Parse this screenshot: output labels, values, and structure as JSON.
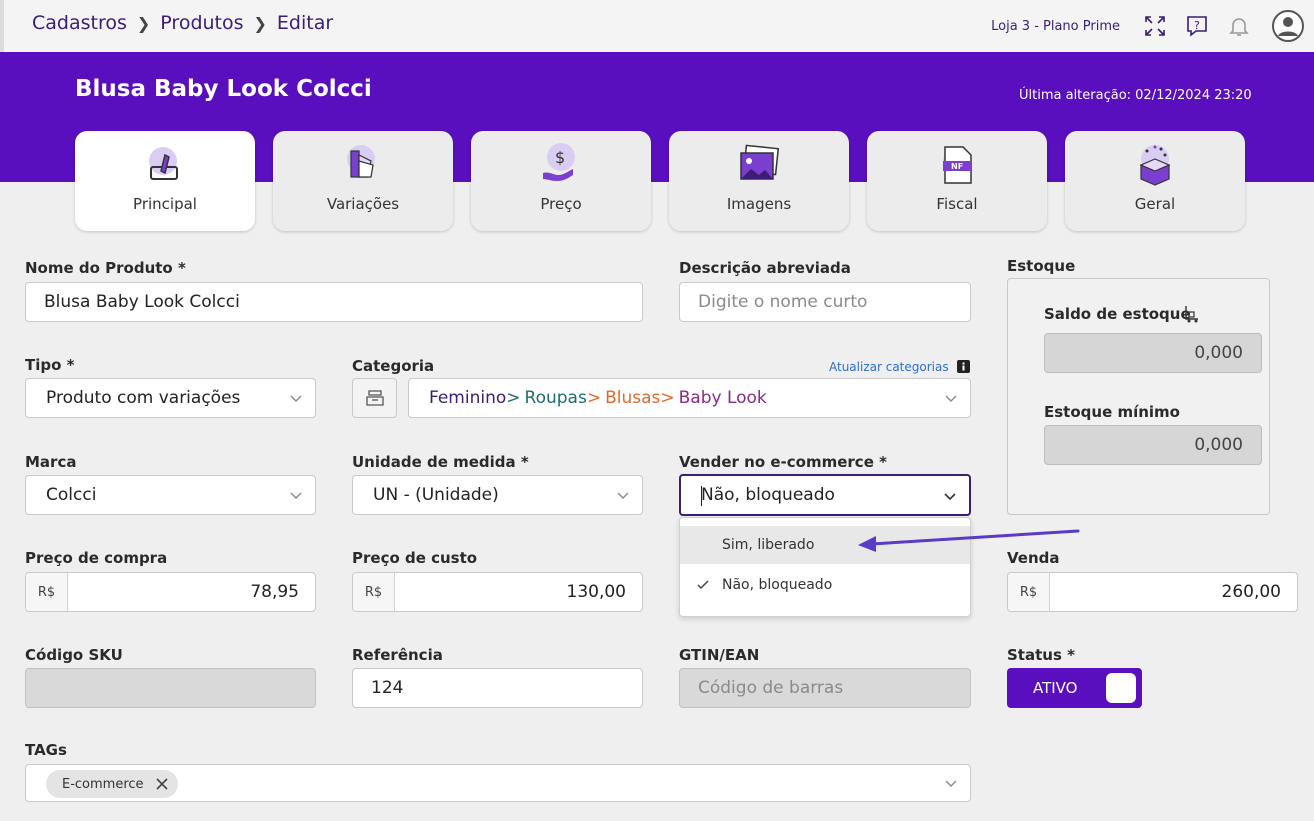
{
  "breadcrumb": [
    "Cadastros",
    "Produtos",
    "Editar"
  ],
  "header": {
    "store": "Loja 3 - Plano Prime",
    "product_title": "Blusa Baby Look Colcci",
    "last_change": "Última alteração: 02/12/2024 23:20"
  },
  "tabs": [
    {
      "label": "Principal",
      "icon": "edit-pencil-icon",
      "active": true
    },
    {
      "label": "Variações",
      "icon": "color-swatch-icon"
    },
    {
      "label": "Preço",
      "icon": "price-hand-icon"
    },
    {
      "label": "Imagens",
      "icon": "images-icon"
    },
    {
      "label": "Fiscal",
      "icon": "nf-document-icon",
      "icon_text": "NF"
    },
    {
      "label": "Geral",
      "icon": "gift-box-icon"
    }
  ],
  "form": {
    "nome": {
      "label": "Nome do Produto *",
      "value": "Blusa Baby Look Colcci"
    },
    "descricao": {
      "label": "Descrição abreviada",
      "placeholder": "Digite o nome curto"
    },
    "tipo": {
      "label": "Tipo *",
      "value": "Produto com variações"
    },
    "categoria": {
      "label": "Categoria",
      "update_link": "Atualizar categorias",
      "path": [
        "Feminino",
        "Roupas",
        "Blusas",
        "Baby Look"
      ],
      "separator": ">"
    },
    "marca": {
      "label": "Marca",
      "value": "Colcci"
    },
    "unidade": {
      "label": "Unidade de medida *",
      "value": "UN - (Unidade)"
    },
    "ecommerce": {
      "label": "Vender no e-commerce *",
      "value": "Não, bloqueado",
      "options": [
        {
          "label": "Sim, liberado",
          "highlighted": true
        },
        {
          "label": "Não, bloqueado",
          "selected": true
        }
      ]
    },
    "preco_compra": {
      "label": "Preço de compra",
      "currency": "R$",
      "value": "78,95"
    },
    "preco_custo": {
      "label": "Preço de custo",
      "currency": "R$",
      "value": "130,00"
    },
    "venda": {
      "label": "Venda",
      "currency": "R$",
      "value": "260,00"
    },
    "sku": {
      "label": "Código SKU",
      "value": ""
    },
    "referencia": {
      "label": "Referência",
      "value": "124"
    },
    "gtin": {
      "label": "GTIN/EAN",
      "placeholder": "Código de barras"
    },
    "status": {
      "label": "Status *",
      "value": "ATIVO"
    },
    "tags": {
      "label": "TAGs",
      "chips": [
        "E-commerce"
      ]
    }
  },
  "estoque": {
    "title": "Estoque",
    "saldo": {
      "label": "Saldo de estoque",
      "value": "0,000"
    },
    "minimo": {
      "label": "Estoque mínimo",
      "value": "0,000"
    }
  },
  "colors": {
    "brand": "#5a0fbf",
    "text_dark": "#3b1d75",
    "link": "#2d6fd2"
  }
}
